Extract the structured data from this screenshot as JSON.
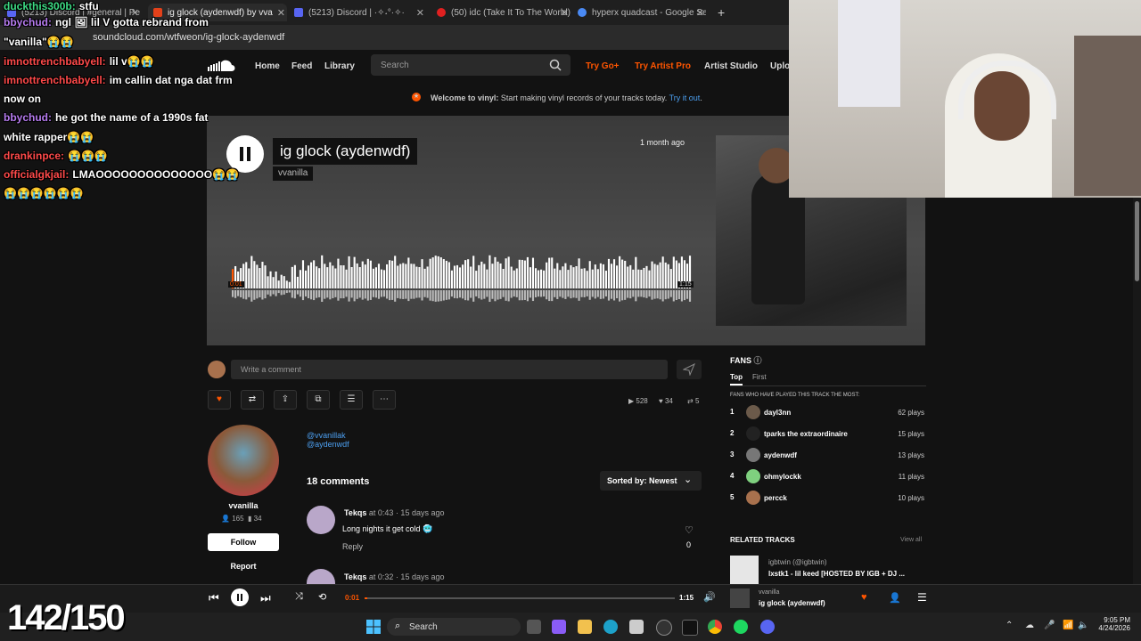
{
  "browser": {
    "tabs": [
      {
        "label": "(5213) Discord | #general | Pe",
        "color": "#5865f2"
      },
      {
        "label": "ig glock (aydenwdf) by vva",
        "color": "#e3411a"
      },
      {
        "label": "(5213) Discord | ·✧˖°·✧·",
        "color": "#5865f2"
      },
      {
        "label": "(50) idc (Take It To The World) -",
        "color": "#e02020"
      },
      {
        "label": "hyperx quadcast - Google Sear",
        "color": "#4a8af4"
      }
    ],
    "url": "soundcloud.com/wtfweon/ig-glock-aydenwdf",
    "new_tab_icon": "+"
  },
  "chat": [
    {
      "user": "duckthis300b",
      "msg": "stfu",
      "color": "#3ddc84"
    },
    {
      "user": "bbychud",
      "msg": "ngl 🖼 lil V gotta rebrand from",
      "color": "#b77cf0"
    },
    {
      "user": "",
      "msg": "\"vanilla\"😭😭",
      "color": "#ffffff"
    },
    {
      "user": "imnottrenchbabyell",
      "msg": "lil v😭😭",
      "color": "#ff4a4a"
    },
    {
      "user": "imnottrenchbabyell",
      "msg": "im callin dat nga dat frm",
      "color": "#ff4a4a"
    },
    {
      "user": "",
      "msg": "now on",
      "color": "#ffffff"
    },
    {
      "user": "bbychud",
      "msg": "he got the name of a 1990s fat",
      "color": "#b77cf0"
    },
    {
      "user": "",
      "msg": "white rapper😭😭",
      "color": "#ffffff"
    },
    {
      "user": "drankinpce",
      "msg": "😭😭😭",
      "color": "#ff4a4a"
    },
    {
      "user": "officialgkjail",
      "msg": "LMAOOOOOOOOOOOOOO😭😭",
      "color": "#ff4a4a"
    },
    {
      "user": "",
      "msg": "😭😭😭😭😭😭",
      "color": "#ffffff"
    }
  ],
  "nav": {
    "home": "Home",
    "feed": "Feed",
    "library": "Library",
    "search_placeholder": "Search",
    "try_go": "Try Go+",
    "try_artist_pro": "Try Artist Pro",
    "artist_studio": "Artist Studio",
    "upload": "Uplo"
  },
  "banner": {
    "bold": "Welcome to vinyl:",
    "text": "Start making vinyl records of your tracks today.",
    "link": "Try it out",
    "end": "."
  },
  "track": {
    "title": "ig glock (aydenwdf)",
    "artist": "vvanilla",
    "posted": "1 month ago",
    "time_start": "0:01",
    "duration": "1:15",
    "progress": 0.01,
    "waveform_seed": 7
  },
  "comment_input": {
    "placeholder": "Write a comment"
  },
  "stats": {
    "plays": "528",
    "likes": "34",
    "reposts": "5"
  },
  "profile": {
    "name": "vvanilla",
    "followers": "165",
    "following": "34",
    "follow_label": "Follow",
    "report_label": "Report"
  },
  "description": {
    "line1": "@vvanillak",
    "line2": "@aydenwdf"
  },
  "comments": {
    "count_label": "18 comments",
    "sort_label": "Sorted by: Newest",
    "items": [
      {
        "user": "Tekqs",
        "at": "at",
        "time": "0:43",
        "ago": "· 15 days ago",
        "text": "Long nights it get cold 🥶",
        "reply": "Reply",
        "likes": "0"
      },
      {
        "user": "Tekqs",
        "at": "at",
        "time": "0:32",
        "ago": "· 15 days ago",
        "text": "",
        "reply": "",
        "likes": ""
      }
    ]
  },
  "fans": {
    "title": "FANS",
    "tabs": [
      "Top",
      "First"
    ],
    "subtitle": "FANS WHO HAVE PLAYED THIS TRACK THE MOST:",
    "list": [
      {
        "rank": "1",
        "name": "dayl3nn",
        "plays": "62 plays",
        "color": "#6b5a4a"
      },
      {
        "rank": "2",
        "name": "tparks the extraordinaire",
        "plays": "15 plays",
        "color": "#222222"
      },
      {
        "rank": "3",
        "name": "aydenwdf",
        "plays": "13 plays",
        "color": "#777777"
      },
      {
        "rank": "4",
        "name": "ohmylockk",
        "plays": "11 plays",
        "color": "#7fd07f"
      },
      {
        "rank": "5",
        "name": "percck",
        "plays": "10 plays",
        "color": "#a8714d"
      }
    ]
  },
  "related": {
    "title": "RELATED TRACKS",
    "view_all": "View all",
    "user": "igbtwin (@igbtwin)",
    "track": "lxstk1 - lil keed [HOSTED BY IGB + DJ ..."
  },
  "player": {
    "now_artist": "vvanilla",
    "now_title": "ig glock (aydenwdf)"
  },
  "overlay": {
    "score": "142/150"
  },
  "taskbar": {
    "search": "Search",
    "time": "9:05 PM",
    "date": "4/24/2026"
  },
  "colors": {
    "accent": "#ff5500",
    "bg": "#121212"
  }
}
